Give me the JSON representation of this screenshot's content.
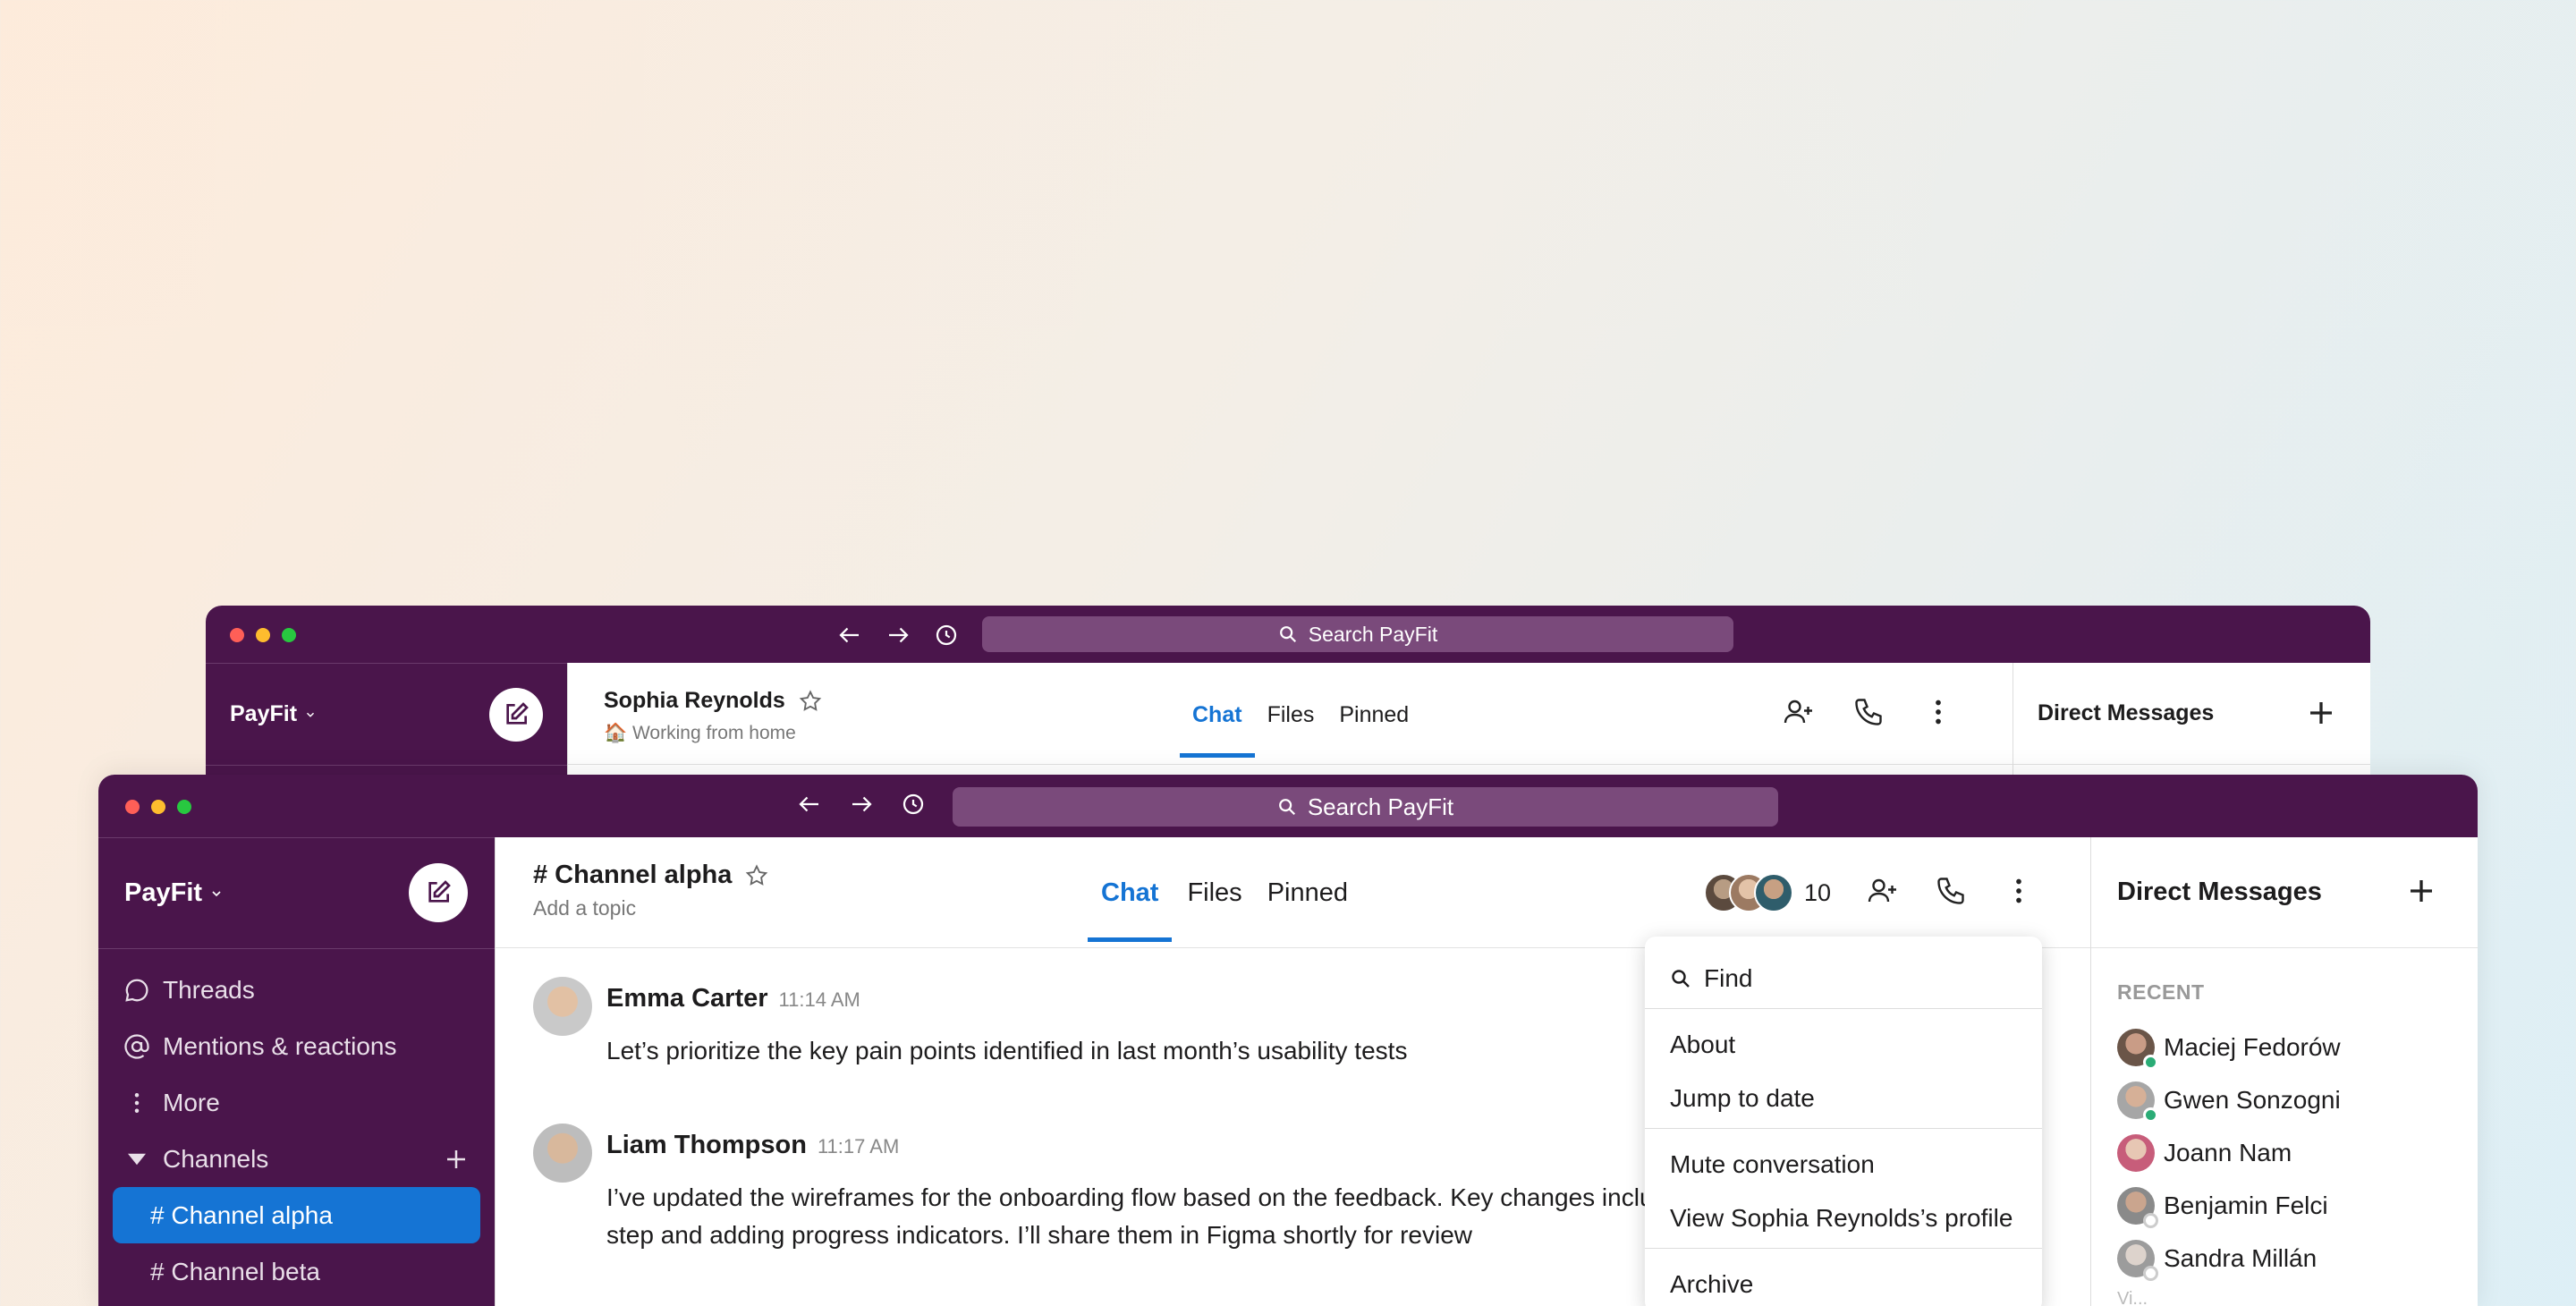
{
  "search_placeholder": "Search PayFit",
  "workspace": "PayFit",
  "back_window": {
    "chat_title": "Sophia Reynolds",
    "status": "🏠 Working from home",
    "tabs": [
      "Chat",
      "Files",
      "Pinned"
    ],
    "right_panel_title": "Direct Messages"
  },
  "front_window": {
    "sidebar": {
      "items": [
        "Threads",
        "Mentions & reactions",
        "More"
      ],
      "channels_label": "Channels",
      "channels": [
        "# Channel alpha",
        "# Channel beta"
      ]
    },
    "channel_title": "# Channel alpha",
    "topic": "Add a topic",
    "tabs": [
      "Chat",
      "Files",
      "Pinned"
    ],
    "member_count": "10",
    "messages": [
      {
        "author": "Emma Carter",
        "time": "11:14 AM",
        "lines": [
          "Let’s prioritize the key pain points identified in last month’s usability tests"
        ]
      },
      {
        "author": "Liam Thompson",
        "time": "11:17 AM",
        "lines": [
          "I’ve updated the wireframes for the onboarding flow based on the feedback. Key changes inclu",
          "step and adding progress indicators. I’ll share them in Figma shortly for review"
        ]
      }
    ],
    "menu": {
      "find": "Find",
      "about": "About",
      "jump_to_date": "Jump to date",
      "mute": "Mute conversation",
      "view_profile": "View Sophia Reynolds’s profile",
      "archive": "Archive"
    },
    "right_panel": {
      "title": "Direct Messages",
      "section": "RECENT",
      "dms": [
        {
          "name": "Maciej Fedorów",
          "online": true
        },
        {
          "name": "Gwen Sonzogni",
          "online": true
        },
        {
          "name": "Joann Nam",
          "online": false
        },
        {
          "name": "Benjamin Felci",
          "online": false
        },
        {
          "name": "Sandra Millán",
          "online": false
        }
      ],
      "more": "Vi..."
    }
  },
  "colors": {
    "titlebar": "#4a154b",
    "accent": "#1574d4",
    "online": "#2bac76"
  }
}
